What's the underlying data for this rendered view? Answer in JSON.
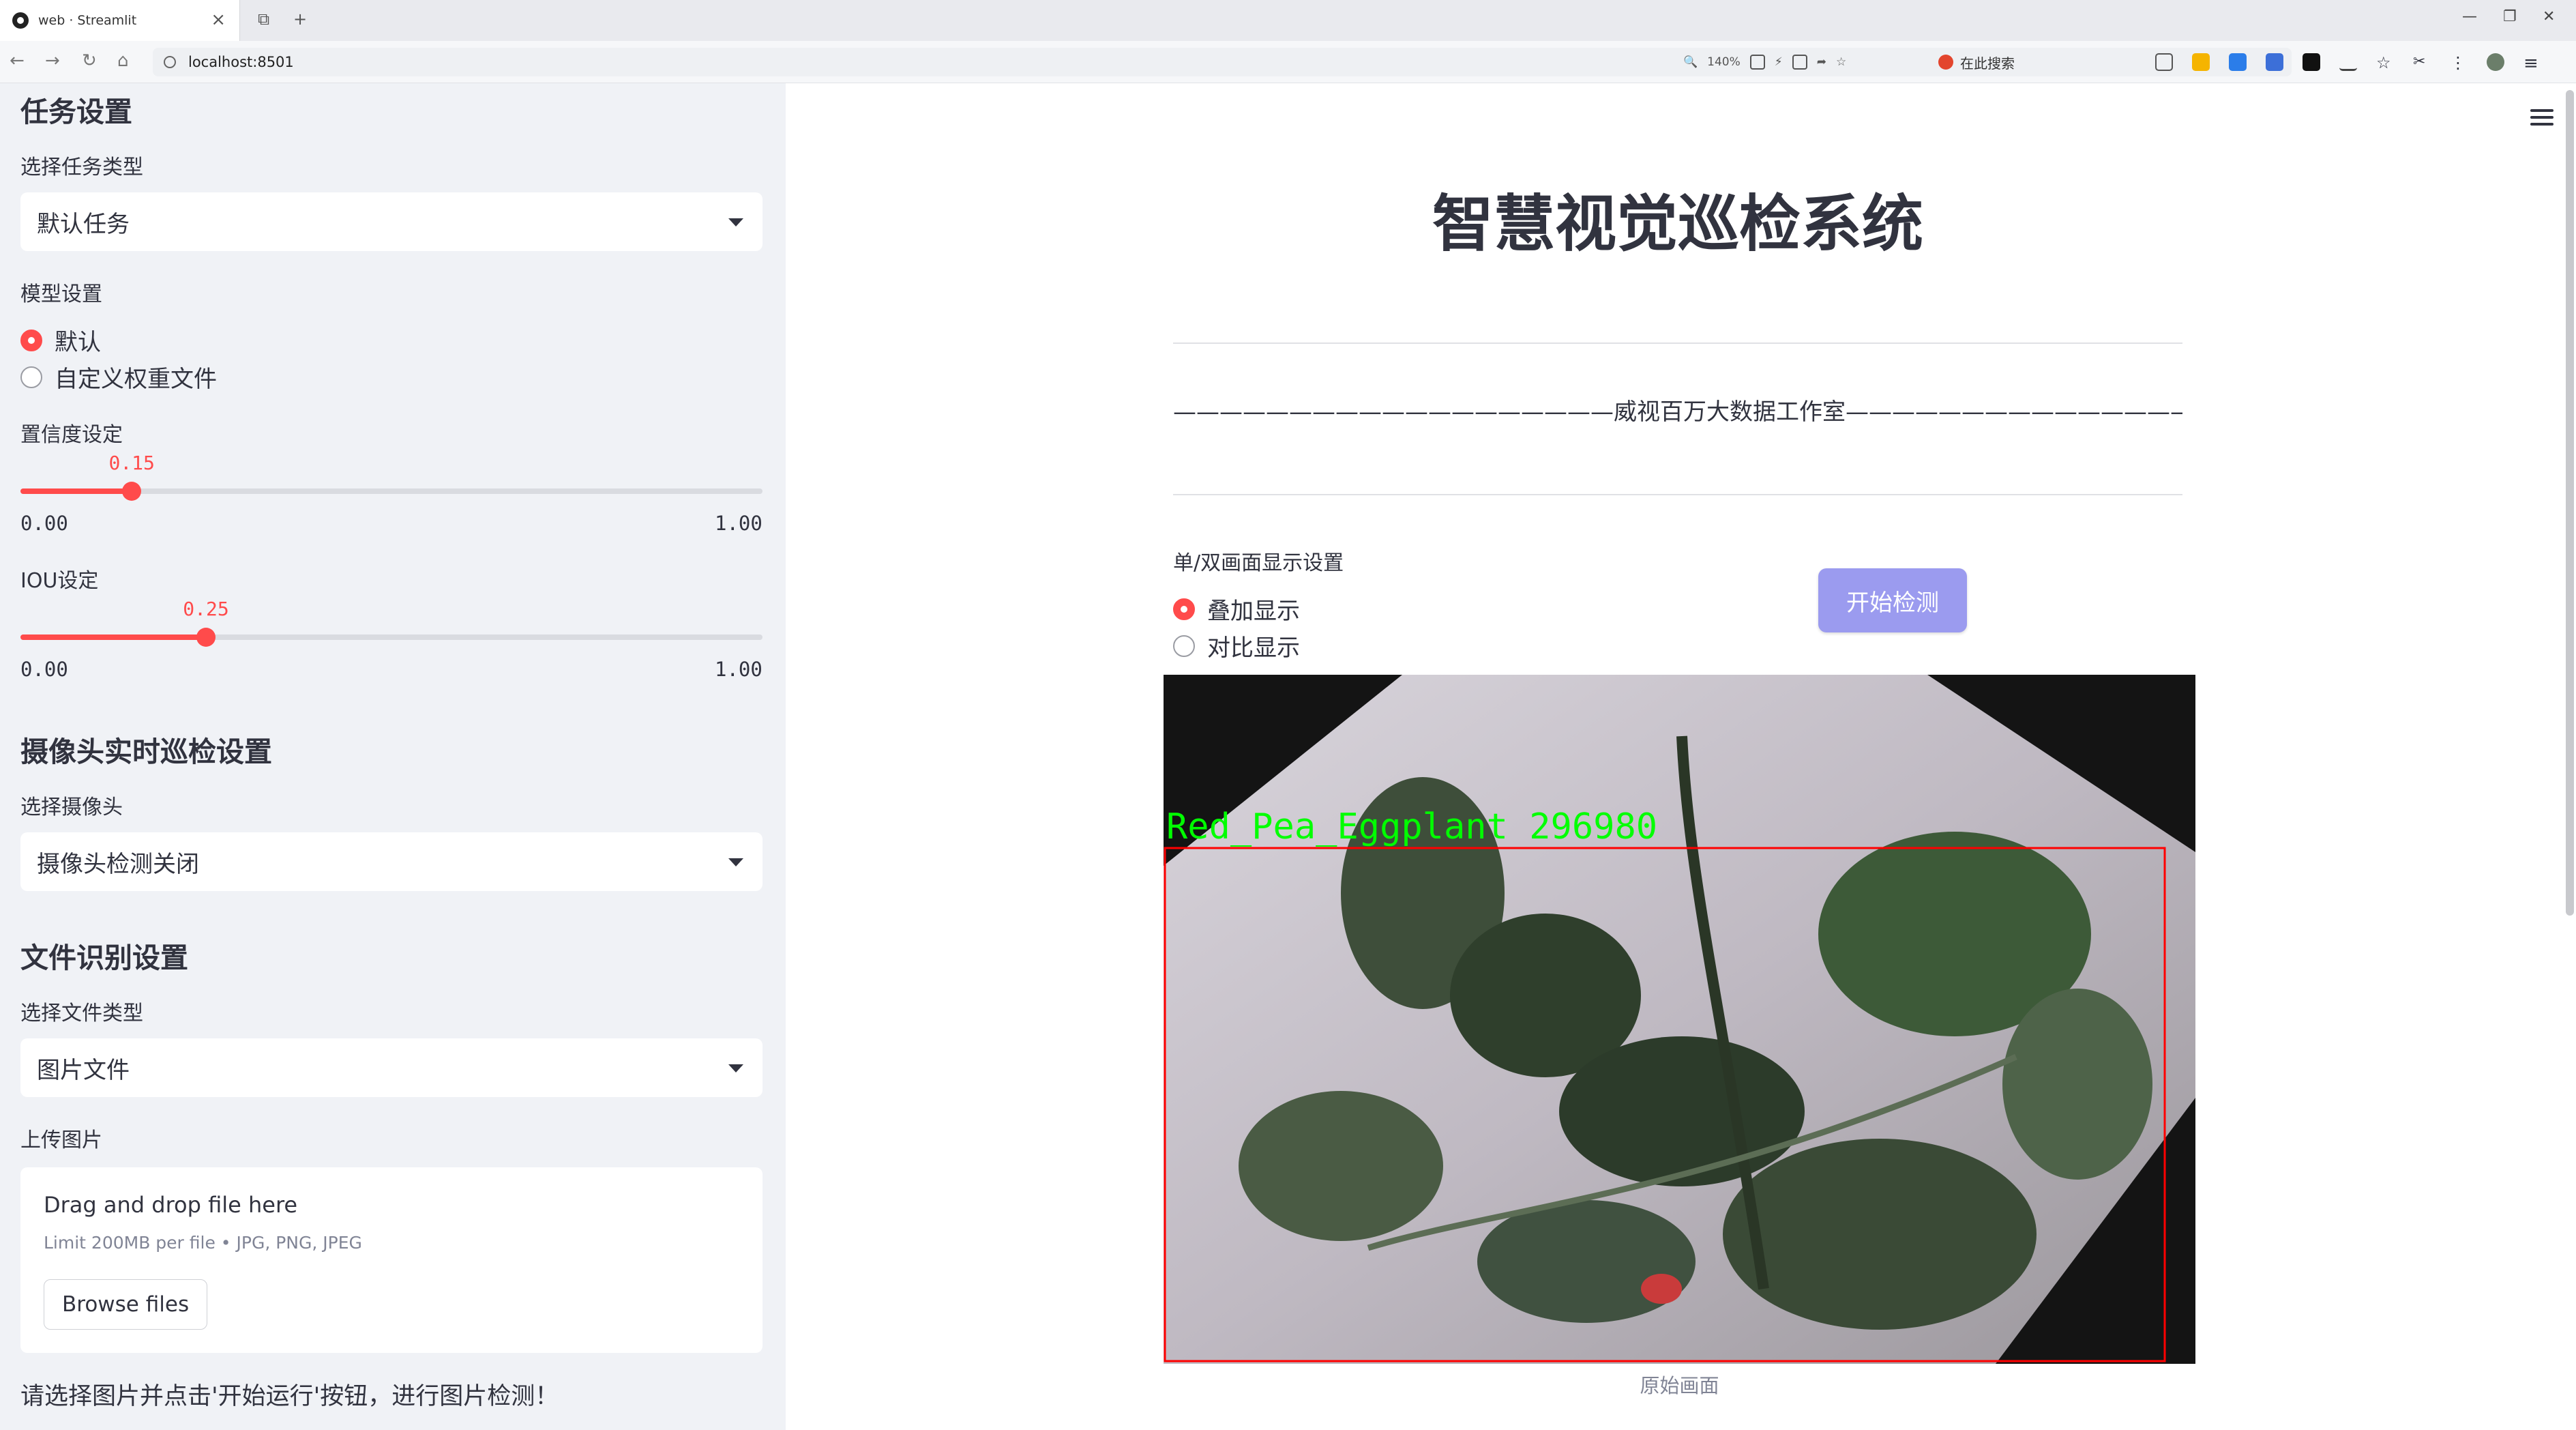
{
  "browser": {
    "tab_title": "web · Streamlit",
    "address": "localhost:8501",
    "zoom": "140%",
    "search_placeholder": "在此搜索"
  },
  "sidebar": {
    "task_heading": "任务设置",
    "task_type_label": "选择任务类型",
    "task_type_value": "默认任务",
    "model_label": "模型设置",
    "model_options": [
      "默认",
      "自定义权重文件"
    ],
    "conf_label": "置信度设定",
    "conf_value": "0.15",
    "conf_min": "0.00",
    "conf_max": "1.00",
    "conf_fraction": 0.15,
    "iou_label": "IOU设定",
    "iou_value": "0.25",
    "iou_min": "0.00",
    "iou_max": "1.00",
    "iou_fraction": 0.25,
    "camera_heading": "摄像头实时巡检设置",
    "camera_label": "选择摄像头",
    "camera_value": "摄像头检测关闭",
    "file_heading": "文件识别设置",
    "file_type_label": "选择文件类型",
    "file_type_value": "图片文件",
    "upload_label": "上传图片",
    "dropzone_title": "Drag and drop file here",
    "dropzone_limit": "Limit 200MB per file • JPG, PNG, JPEG",
    "browse_label": "Browse files",
    "note": "请选择图片并点击'开始运行'按钮，进行图片检测！"
  },
  "main": {
    "title": "智慧视觉巡检系统",
    "subtitle": "———————————————————威视百万大数据工作室————————————————————",
    "display_label": "单/双画面显示设置",
    "display_options": [
      "叠加显示",
      "对比显示"
    ],
    "run_button": "开始检测",
    "detection_label": "Red_Pea_Eggplant  296980",
    "caption": "原始画面"
  },
  "colors": {
    "accent": "#ff4b4b",
    "button": "#9b9bef",
    "detection_text": "#00ff00",
    "detection_box": "#ff0000"
  }
}
